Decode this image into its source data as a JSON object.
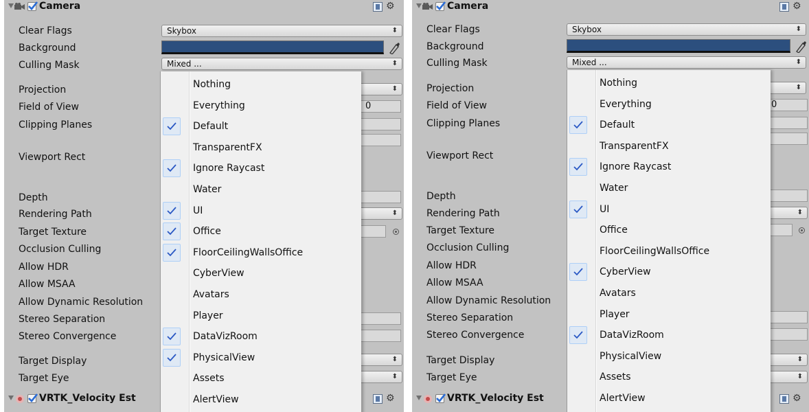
{
  "panels": [
    {
      "camera_component": {
        "title": "Camera",
        "enabled": true
      },
      "fields": {
        "clear_flags": {
          "label": "Clear Flags",
          "value": "Skybox"
        },
        "background": {
          "label": "Background",
          "color": "#2c4f7e"
        },
        "culling_mask": {
          "label": "Culling Mask",
          "value": "Mixed ..."
        },
        "projection": {
          "label": "Projection"
        },
        "field_of_view": {
          "label": "Field of View",
          "value_fragment": "0"
        },
        "clipping_planes": {
          "label": "Clipping Planes"
        },
        "viewport_rect": {
          "label": "Viewport Rect"
        },
        "depth": {
          "label": "Depth"
        },
        "rendering_path": {
          "label": "Rendering Path"
        },
        "target_texture": {
          "label": "Target Texture"
        },
        "occlusion_culling": {
          "label": "Occlusion Culling"
        },
        "allow_hdr": {
          "label": "Allow HDR"
        },
        "allow_msaa": {
          "label": "Allow MSAA"
        },
        "allow_dynamic_resolution": {
          "label": "Allow Dynamic Resolution"
        },
        "stereo_separation": {
          "label": "Stereo Separation"
        },
        "stereo_convergence": {
          "label": "Stereo Convergence"
        },
        "target_display": {
          "label": "Target Display"
        },
        "target_eye": {
          "label": "Target Eye"
        }
      },
      "next_component": {
        "title": "VRTK_Velocity Est",
        "enabled": true
      },
      "culling_menu": [
        {
          "label": "Nothing",
          "checked": false
        },
        {
          "label": "Everything",
          "checked": false
        },
        {
          "label": "Default",
          "checked": true
        },
        {
          "label": "TransparentFX",
          "checked": false
        },
        {
          "label": "Ignore Raycast",
          "checked": true
        },
        {
          "label": "Water",
          "checked": false
        },
        {
          "label": "UI",
          "checked": true
        },
        {
          "label": "Office",
          "checked": true
        },
        {
          "label": "FloorCeilingWallsOffice",
          "checked": true
        },
        {
          "label": "CyberView",
          "checked": false
        },
        {
          "label": "Avatars",
          "checked": false
        },
        {
          "label": "Player",
          "checked": false
        },
        {
          "label": "DataVizRoom",
          "checked": true
        },
        {
          "label": "PhysicalView",
          "checked": true
        },
        {
          "label": "Assets",
          "checked": false
        },
        {
          "label": "AlertView",
          "checked": false
        }
      ]
    },
    {
      "camera_component": {
        "title": "Camera",
        "enabled": true
      },
      "fields": {
        "clear_flags": {
          "label": "Clear Flags",
          "value": "Skybox"
        },
        "background": {
          "label": "Background",
          "color": "#2c4f7e"
        },
        "culling_mask": {
          "label": "Culling Mask",
          "value": "Mixed ..."
        },
        "projection": {
          "label": "Projection"
        },
        "field_of_view": {
          "label": "Field of View",
          "value_fragment": "0"
        },
        "clipping_planes": {
          "label": "Clipping Planes"
        },
        "viewport_rect": {
          "label": "Viewport Rect"
        },
        "depth": {
          "label": "Depth"
        },
        "rendering_path": {
          "label": "Rendering Path"
        },
        "target_texture": {
          "label": "Target Texture"
        },
        "occlusion_culling": {
          "label": "Occlusion Culling"
        },
        "allow_hdr": {
          "label": "Allow HDR"
        },
        "allow_msaa": {
          "label": "Allow MSAA"
        },
        "allow_dynamic_resolution": {
          "label": "Allow Dynamic Resolution"
        },
        "stereo_separation": {
          "label": "Stereo Separation"
        },
        "stereo_convergence": {
          "label": "Stereo Convergence"
        },
        "target_display": {
          "label": "Target Display"
        },
        "target_eye": {
          "label": "Target Eye"
        }
      },
      "next_component": {
        "title": "VRTK_Velocity Est",
        "enabled": true
      },
      "culling_menu": [
        {
          "label": "Nothing",
          "checked": false
        },
        {
          "label": "Everything",
          "checked": false
        },
        {
          "label": "Default",
          "checked": true
        },
        {
          "label": "TransparentFX",
          "checked": false
        },
        {
          "label": "Ignore Raycast",
          "checked": true
        },
        {
          "label": "Water",
          "checked": false
        },
        {
          "label": "UI",
          "checked": true
        },
        {
          "label": "Office",
          "checked": false
        },
        {
          "label": "FloorCeilingWallsOffice",
          "checked": false
        },
        {
          "label": "CyberView",
          "checked": true
        },
        {
          "label": "Avatars",
          "checked": false
        },
        {
          "label": "Player",
          "checked": false
        },
        {
          "label": "DataVizRoom",
          "checked": true
        },
        {
          "label": "PhysicalView",
          "checked": false
        },
        {
          "label": "Assets",
          "checked": false
        },
        {
          "label": "AlertView",
          "checked": false
        }
      ]
    }
  ]
}
